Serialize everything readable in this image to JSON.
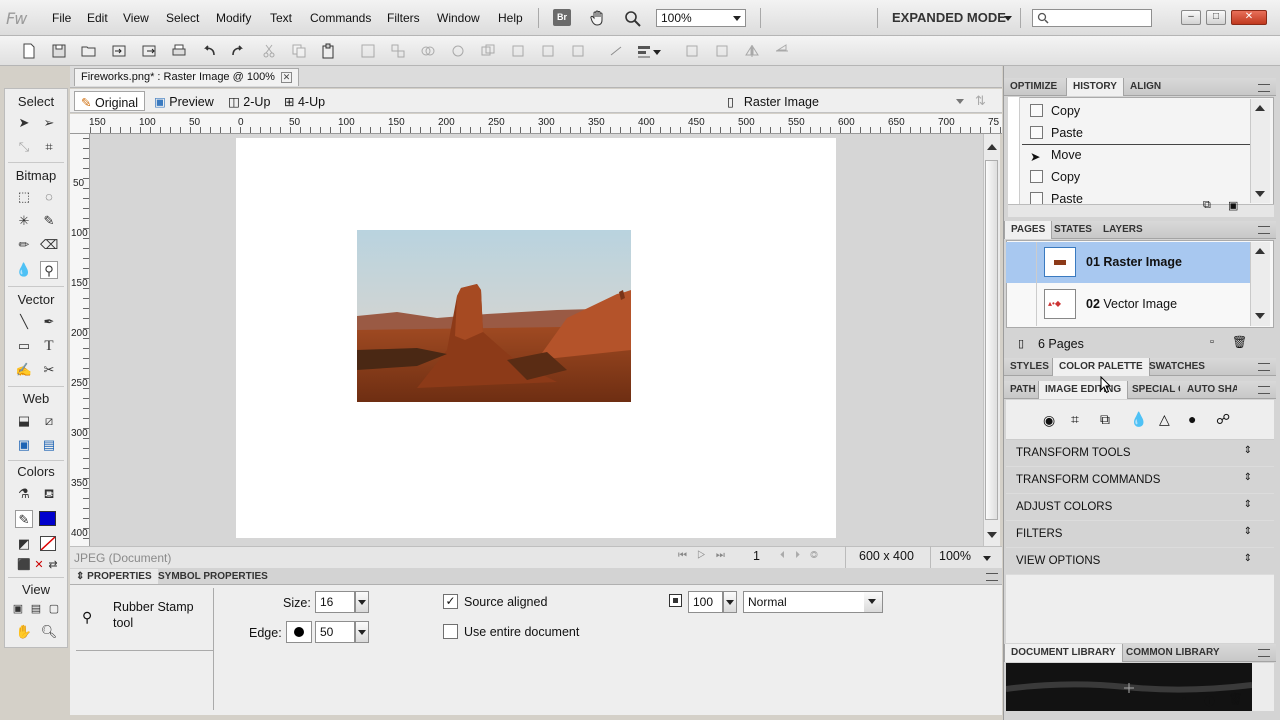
{
  "app": {
    "logo": "Fw"
  },
  "menu": [
    "File",
    "Edit",
    "View",
    "Select",
    "Modify",
    "Text",
    "Commands",
    "Filters",
    "Window",
    "Help"
  ],
  "appbar": {
    "bridge_label": "Br",
    "zoom": "100%",
    "mode": "EXPANDED MODE"
  },
  "document": {
    "tab_title": "Fireworks.png* : Raster Image @ 100%",
    "view_tabs": [
      "Original",
      "Preview",
      "2-Up",
      "4-Up"
    ],
    "page_selector": "Raster Image",
    "ruler_h": [
      "150",
      "100",
      "50",
      "0",
      "50",
      "100",
      "150",
      "200",
      "250",
      "300",
      "350",
      "400",
      "450",
      "500",
      "550",
      "600",
      "650",
      "700",
      "75"
    ],
    "ruler_v": [
      "50",
      "100",
      "150",
      "200",
      "250",
      "300",
      "350",
      "400"
    ],
    "status_doc": "JPEG (Document)",
    "frame": "1",
    "size": "600 x 400",
    "zoom": "100%"
  },
  "tools": {
    "sections": [
      "Select",
      "Bitmap",
      "Vector",
      "Web",
      "Colors",
      "View"
    ]
  },
  "properties": {
    "tabs": [
      "PROPERTIES",
      "SYMBOL PROPERTIES"
    ],
    "tool_name": "Rubber Stamp tool",
    "size_label": "Size:",
    "size_value": "16",
    "edge_label": "Edge:",
    "edge_value": "50",
    "source_aligned": "Source aligned",
    "use_entire": "Use entire document",
    "opacity": "100",
    "blend_mode": "Normal"
  },
  "panels": {
    "top_tabs": [
      "OPTIMIZE",
      "HISTORY",
      "ALIGN"
    ],
    "history": [
      "Copy",
      "Paste",
      "Move",
      "Copy",
      "Paste"
    ],
    "pages_tabs": [
      "PAGES",
      "STATES",
      "LAYERS"
    ],
    "pages": [
      {
        "num": "01",
        "name": "Raster Image"
      },
      {
        "num": "02",
        "name": "Vector Image"
      }
    ],
    "pages_count": "6 Pages",
    "style_tabs": [
      "STYLES",
      "COLOR PALETTE",
      "SWATCHES"
    ],
    "edit_tabs": [
      "PATH",
      "IMAGE EDITING",
      "SPECIAL C",
      "AUTO SHA"
    ],
    "sections": [
      "TRANSFORM TOOLS",
      "TRANSFORM COMMANDS",
      "ADJUST COLORS",
      "FILTERS",
      "VIEW OPTIONS"
    ],
    "library_tabs": [
      "DOCUMENT LIBRARY",
      "COMMON LIBRARY"
    ]
  },
  "colors": {
    "accent_select": "#a8c8f0",
    "stroke": "#000000",
    "fill": "#0000cc"
  }
}
